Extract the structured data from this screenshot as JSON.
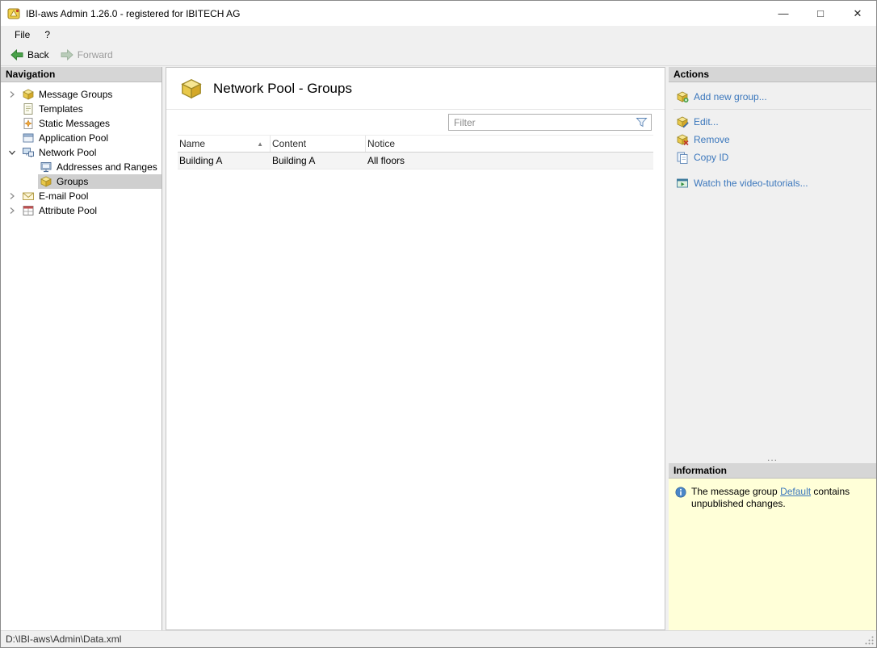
{
  "window": {
    "title": "IBI-aws Admin 1.26.0 - registered for IBITECH AG"
  },
  "icons": {
    "minimize": "—",
    "maximize": "□",
    "close": "✕",
    "sort_asc": "▲"
  },
  "menu": {
    "items": [
      {
        "label": "File"
      },
      {
        "label": "?"
      }
    ]
  },
  "toolbar": {
    "back_label": "Back",
    "forward_label": "Forward"
  },
  "navigation": {
    "header": "Navigation",
    "items": [
      {
        "label": "Message Groups",
        "level": 0,
        "has_children": true,
        "expanded": false
      },
      {
        "label": "Templates",
        "level": 0,
        "has_children": false
      },
      {
        "label": "Static Messages",
        "level": 0,
        "has_children": false
      },
      {
        "label": "Application Pool",
        "level": 0,
        "has_children": false
      },
      {
        "label": "Network Pool",
        "level": 0,
        "has_children": true,
        "expanded": true
      },
      {
        "label": "Addresses and Ranges",
        "level": 1,
        "has_children": false
      },
      {
        "label": "Groups",
        "level": 1,
        "has_children": false,
        "selected": true
      },
      {
        "label": "E-mail Pool",
        "level": 0,
        "has_children": true,
        "expanded": false
      },
      {
        "label": "Attribute Pool",
        "level": 0,
        "has_children": true,
        "expanded": false
      }
    ]
  },
  "main": {
    "title": "Network Pool - Groups",
    "filter_placeholder": "Filter",
    "table": {
      "columns": [
        "Name",
        "Content",
        "Notice"
      ],
      "sort": {
        "column": "Name",
        "direction": "asc"
      },
      "rows": [
        [
          "Building A",
          "Building A",
          "All floors"
        ]
      ]
    }
  },
  "actions": {
    "header": "Actions",
    "items": [
      {
        "label": "Add new group..."
      },
      {
        "label": "Edit..."
      },
      {
        "label": "Remove"
      },
      {
        "label": "Copy ID"
      },
      {
        "label": "Watch the video-tutorials..."
      }
    ],
    "overflow": "..."
  },
  "information": {
    "header": "Information",
    "text_before": "The message group ",
    "link": "Default",
    "text_after": " contains unpublished changes."
  },
  "statusbar": {
    "path": "D:\\IBI-aws\\Admin\\Data.xml"
  },
  "colors": {
    "link_accent": "#3b77bc",
    "info_background": "#ffffd8",
    "selection_background": "#cfcfcf",
    "panel_header_background": "#d6d6d6"
  }
}
